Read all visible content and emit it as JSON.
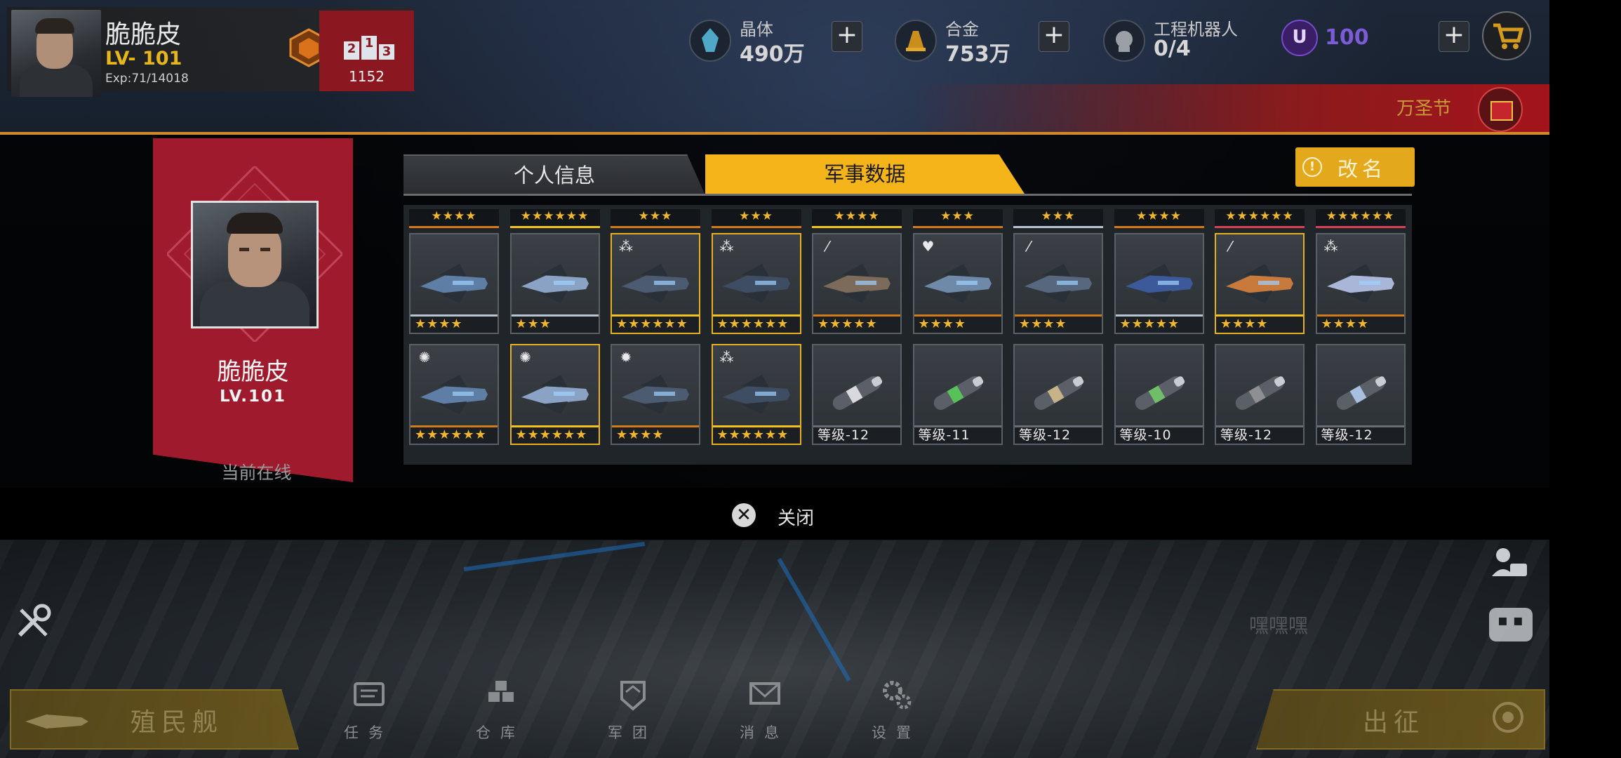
{
  "player": {
    "name": "脆脆皮",
    "level": "LV- 101",
    "exp": "Exp:71/14018",
    "rank_score": "1152"
  },
  "resources": {
    "crystal": {
      "label": "晶体",
      "value": "490万"
    },
    "alloy": {
      "label": "合金",
      "value": "753万"
    },
    "robots": {
      "label": "工程机器人",
      "value": "0/4"
    },
    "u_coin": {
      "symbol": "U",
      "value": "100"
    }
  },
  "event": {
    "label": "万圣节"
  },
  "profile": {
    "name": "脆脆皮",
    "level": "LV.101",
    "status": "当前在线"
  },
  "tabs": {
    "personal": "个人信息",
    "military": "军事数据",
    "active": "military"
  },
  "rename_button": "改名",
  "grid": {
    "top_row": [
      {
        "stars": "★★★★",
        "accent": "orange"
      },
      {
        "stars": "★★★★★★",
        "accent": "gold"
      },
      {
        "stars": "★★★",
        "accent": "orange"
      },
      {
        "stars": "★★★",
        "accent": "orange"
      },
      {
        "stars": "★★★★",
        "accent": "gold"
      },
      {
        "stars": "★★★",
        "accent": "orange"
      },
      {
        "stars": "★★★",
        "accent": "silver"
      },
      {
        "stars": "★★★★",
        "accent": "orange"
      },
      {
        "stars": "★★★★★★",
        "accent": "red"
      },
      {
        "stars": "★★★★★★",
        "accent": "red"
      }
    ],
    "row1": [
      {
        "badge": "",
        "footer": "★★★★",
        "accent": "silver",
        "highlight": false,
        "art": "ship-a"
      },
      {
        "badge": "",
        "footer": "★★★",
        "accent": "silver",
        "highlight": false,
        "art": "ship-b"
      },
      {
        "badge": "⁂",
        "footer": "★★★★★★",
        "accent": "gold",
        "highlight": true,
        "art": "ship-c"
      },
      {
        "badge": "⁂",
        "footer": "★★★★★★",
        "accent": "gold",
        "highlight": true,
        "art": "ship-d"
      },
      {
        "badge": "⁄",
        "footer": "★★★★★",
        "accent": "orange",
        "highlight": false,
        "art": "ship-e"
      },
      {
        "badge": "♥",
        "footer": "★★★★",
        "accent": "orange",
        "highlight": false,
        "art": "ship-f"
      },
      {
        "badge": "⁄",
        "footer": "★★★★",
        "accent": "orange",
        "highlight": false,
        "art": "ship-g"
      },
      {
        "badge": "",
        "footer": "★★★★★",
        "accent": "silver",
        "highlight": false,
        "art": "ship-h"
      },
      {
        "badge": "⁄",
        "footer": "★★★★",
        "accent": "gold",
        "highlight": true,
        "art": "ship-i"
      },
      {
        "badge": "⁂",
        "footer": "★★★★",
        "accent": "orange",
        "highlight": false,
        "art": "ship-j"
      }
    ],
    "row2": [
      {
        "badge": "✺",
        "footer": "★★★★★★",
        "accent": "orange",
        "highlight": false,
        "art": "ship-k"
      },
      {
        "badge": "✺",
        "footer": "★★★★★★",
        "accent": "gold",
        "highlight": true,
        "art": "ship-l"
      },
      {
        "badge": "✹",
        "footer": "★★★★",
        "accent": "orange",
        "highlight": false,
        "art": "ship-m"
      },
      {
        "badge": "⁂",
        "footer": "★★★★★★",
        "accent": "gold",
        "highlight": true,
        "art": "ship-n"
      },
      {
        "badge": "",
        "footer": "等级-12",
        "accent": "level",
        "highlight": false,
        "art": "weapon-a"
      },
      {
        "badge": "",
        "footer": "等级-11",
        "accent": "level",
        "highlight": false,
        "art": "weapon-b"
      },
      {
        "badge": "",
        "footer": "等级-12",
        "accent": "level",
        "highlight": false,
        "art": "weapon-c"
      },
      {
        "badge": "",
        "footer": "等级-10",
        "accent": "level",
        "highlight": false,
        "art": "weapon-d"
      },
      {
        "badge": "",
        "footer": "等级-12",
        "accent": "level",
        "highlight": false,
        "art": "weapon-e"
      },
      {
        "badge": "",
        "footer": "等级-12",
        "accent": "level",
        "highlight": false,
        "art": "weapon-f"
      }
    ]
  },
  "close_label": "关闭",
  "chat_placeholder": "嘿嘿嘿",
  "bottom_nav": [
    {
      "label": "任务",
      "icon": "tasks-icon"
    },
    {
      "label": "仓库",
      "icon": "warehouse-icon"
    },
    {
      "label": "军团",
      "icon": "legion-icon"
    },
    {
      "label": "消息",
      "icon": "messages-icon"
    },
    {
      "label": "设置",
      "icon": "settings-icon"
    }
  ],
  "colony_button": "殖民舰",
  "sortie_button": "出征",
  "colors": {
    "accent_gold": "#f4b41a",
    "banner_red": "#9e1a2c",
    "star_gold": "#f1b72a",
    "orange_border": "#d07a1a"
  }
}
